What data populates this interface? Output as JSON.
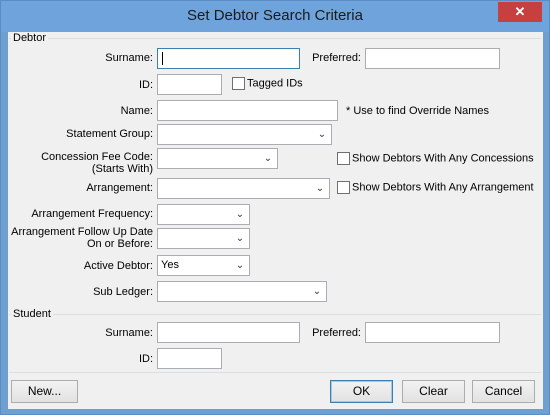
{
  "window": {
    "title": "Set Debtor Search Criteria",
    "close_glyph": "✕"
  },
  "debtor": {
    "group_label": "Debtor",
    "surname_label": "Surname:",
    "surname_value": "",
    "preferred_label": "Preferred:",
    "preferred_value": "",
    "id_label": "ID:",
    "id_value": "",
    "tagged_ids_label": "Tagged IDs",
    "name_label": "Name:",
    "name_value": "",
    "name_note": "* Use to find Override Names",
    "statement_group_label": "Statement Group:",
    "statement_group_value": "",
    "concession_label_line1": "Concession Fee Code:",
    "concession_label_line2": "(Starts With)",
    "concession_value": "",
    "show_concessions_label": "Show Debtors With Any Concessions",
    "arrangement_label": "Arrangement:",
    "arrangement_value": "",
    "show_arrangement_label": "Show Debtors With Any Arrangement",
    "arrangement_frequency_label": "Arrangement Frequency:",
    "arrangement_frequency_value": "",
    "followup_label_line1": "Arrangement Follow Up Date",
    "followup_label_line2": "On or Before:",
    "followup_value": "",
    "active_debtor_label": "Active Debtor:",
    "active_debtor_value": "Yes",
    "sub_ledger_label": "Sub Ledger:",
    "sub_ledger_value": ""
  },
  "student": {
    "group_label": "Student",
    "surname_label": "Surname:",
    "surname_value": "",
    "preferred_label": "Preferred:",
    "preferred_value": "",
    "id_label": "ID:",
    "id_value": ""
  },
  "buttons": {
    "new": "New...",
    "ok": "OK",
    "clear": "Clear",
    "cancel": "Cancel"
  },
  "icons": {
    "dropdown": "chevron-down-icon",
    "close": "close-icon"
  },
  "colors": {
    "title_bar": "#6fa3db",
    "close": "#c74040",
    "focus": "#3c7fb1"
  }
}
